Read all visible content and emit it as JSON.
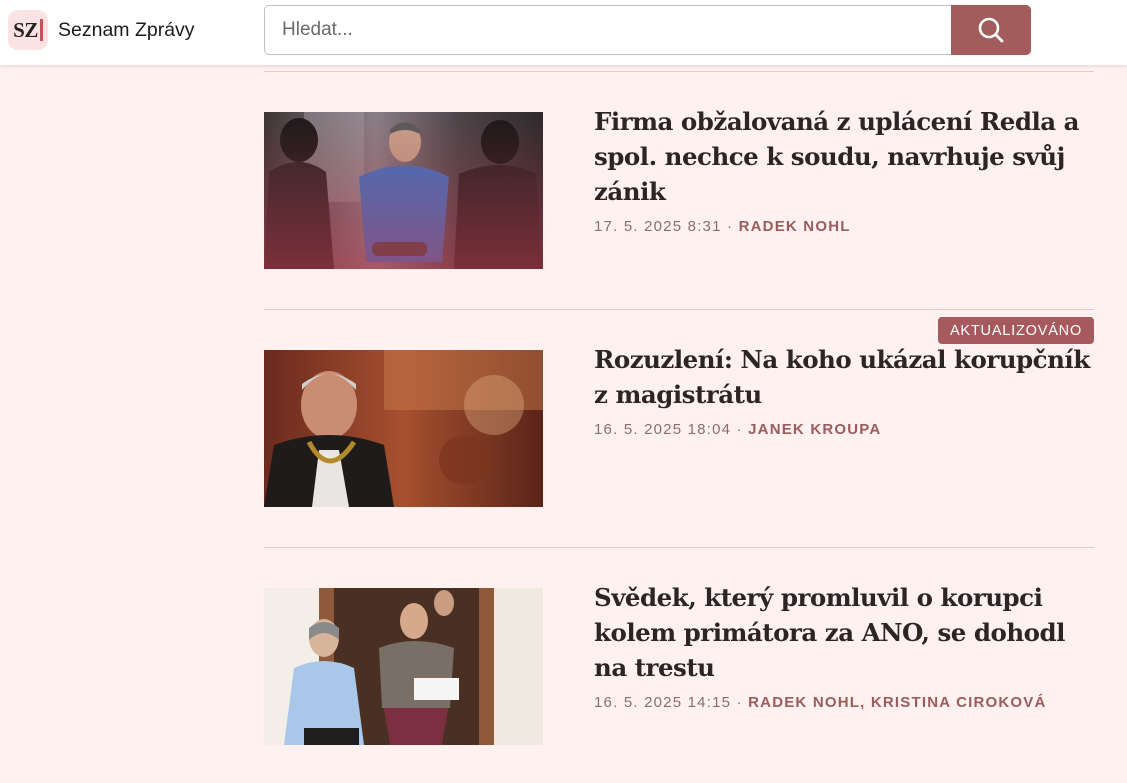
{
  "header": {
    "logo": "SZ",
    "site_name": "Seznam Zprávy",
    "search_placeholder": "Hledat...",
    "search_icon": "search-icon"
  },
  "articles": [
    {
      "title": "Firma obžalovaná z uplácení Redla a spol. nechce k soudu, navrhuje svůj zánik",
      "date": "17. 5. 2025 8:31",
      "separator": "·",
      "authors": "Radek Nohl",
      "badge": ""
    },
    {
      "title": "Rozuzlení: Na koho ukázal korupčník z magistrátu",
      "date": "16. 5. 2025 18:04",
      "separator": "·",
      "authors": "Janek Kroupa",
      "badge": "AKTUALIZOVÁNO"
    },
    {
      "title": "Svědek, který promluvil o korupci kolem primátora za ANO, se dohodl na trestu",
      "date": "16. 5. 2025 14:15",
      "separator": "·",
      "authors": "Radek Nohl, Kristina Ciroková",
      "badge": ""
    }
  ],
  "colors": {
    "background": "#fff1f0",
    "accent": "#a25c5c",
    "author": "#9a5c5c"
  }
}
